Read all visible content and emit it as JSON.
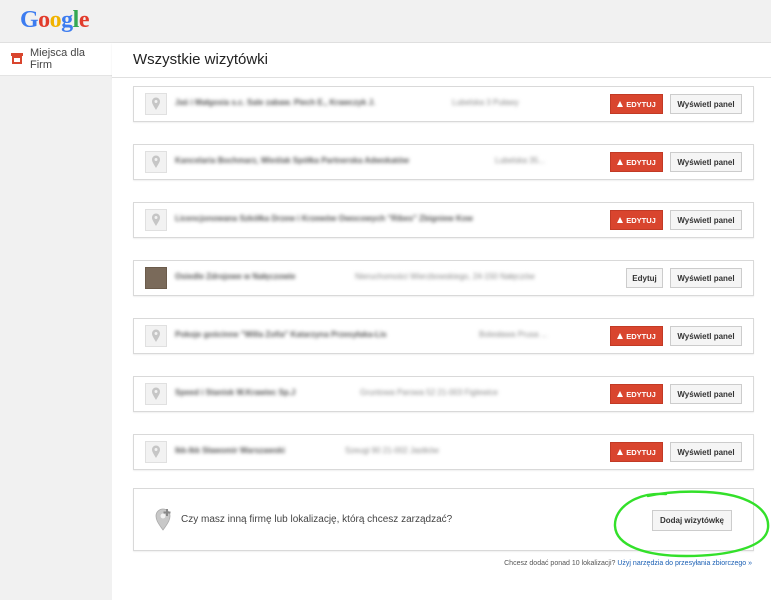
{
  "header": {
    "logo_letters": [
      {
        "ch": "G",
        "color": "#3c7cf0"
      },
      {
        "ch": "o",
        "color": "#e23c2c"
      },
      {
        "ch": "o",
        "color": "#f1b300"
      },
      {
        "ch": "g",
        "color": "#3c7cf0"
      },
      {
        "ch": "l",
        "color": "#33a853"
      },
      {
        "ch": "e",
        "color": "#e23c2c"
      }
    ]
  },
  "sidebar": {
    "item_label": "Miejsca dla Firm",
    "item_icon": "storefront-icon"
  },
  "main": {
    "title": "Wszystkie wizytówki"
  },
  "listings": [
    {
      "name": "Jaś i Małgosia s.c. Sale zabaw. Piech E., Krawczyk J.",
      "address": "Lubelska 3 Puławy",
      "edit_label": "EDYTUJ",
      "edit_style": "warning",
      "panel_label": "Wyświetl panel",
      "icon": "map-pin-icon"
    },
    {
      "name": "Kancelaria Bochmarz, Wieślak Spółka Partnerska Adwokatów",
      "address": "Lubelska 35...",
      "edit_label": "EDYTUJ",
      "edit_style": "warning",
      "panel_label": "Wyświetl panel",
      "icon": "map-pin-icon"
    },
    {
      "name": "Licencjonowana Szkółka Drzew i Krzewów Owocowych \"Ribes\" Zbigniew Kow",
      "address": "",
      "edit_label": "EDYTUJ",
      "edit_style": "warning",
      "panel_label": "Wyświetl panel",
      "icon": "map-pin-icon"
    },
    {
      "name": "Osiedle Zdrojowe w Nałęczowie",
      "address": "Nieruchomości   Wierzbowskiego, 24-150 Nałęczów",
      "edit_label": "Edytuj",
      "edit_style": "plain",
      "panel_label": "Wyświetl panel",
      "icon": "photo-thumbnail"
    },
    {
      "name": "Pokoje gościnne \"Willa Zofia\" Katarzyna Przesyłaka-Lis",
      "address": "Bolesława Prusa ...",
      "edit_label": "EDYTUJ",
      "edit_style": "warning",
      "panel_label": "Wyświetl panel",
      "icon": "map-pin-icon"
    },
    {
      "name": "Speed i Stanisk W.Krawiec Sp.J",
      "address": "Gruntowa Parowa 52 21-003 Figlewice",
      "edit_label": "EDYTUJ",
      "edit_style": "warning",
      "panel_label": "Wyświetl panel",
      "icon": "map-pin-icon"
    },
    {
      "name": "Ikk-Ikk Sławomir Warszawski",
      "address": "Szeugi 90 21-002 Jastków",
      "edit_label": "EDYTUJ",
      "edit_style": "warning",
      "panel_label": "Wyświetl panel",
      "icon": "map-pin-icon"
    }
  ],
  "add_business": {
    "question": "Czy masz inną firmę lub lokalizację, którą chcesz zarządzać?",
    "button_label": "Dodaj wizytówkę",
    "icon": "map-pin-add-icon"
  },
  "footer": {
    "note": "Chcesz dodać ponad 10 lokalizacji?",
    "link_label": "Użyj narzędzia do przesyłania zbiorczego »"
  },
  "colors": {
    "edit_warning_bg": "#d9452e",
    "link": "#1a5fb4",
    "annotation": "#33e02a"
  }
}
